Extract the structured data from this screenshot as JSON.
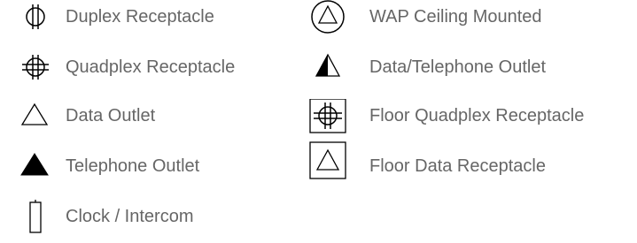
{
  "legend": {
    "items": [
      {
        "label": "Duplex Receptacle",
        "icon": "duplex-receptacle-symbol"
      },
      {
        "label": "Quadplex Receptacle",
        "icon": "quadplex-receptacle-symbol"
      },
      {
        "label": "Data Outlet",
        "icon": "data-outlet-symbol"
      },
      {
        "label": "Telephone Outlet",
        "icon": "telephone-outlet-symbol"
      },
      {
        "label": "Clock / Intercom",
        "icon": "clock-intercom-symbol"
      },
      {
        "label": "WAP Ceiling Mounted",
        "icon": "wap-ceiling-mounted-symbol"
      },
      {
        "label": "Data/Telephone Outlet",
        "icon": "data-telephone-outlet-symbol"
      },
      {
        "label": "Floor Quadplex Receptacle",
        "icon": "floor-quadplex-receptacle-symbol"
      },
      {
        "label": "Floor Data Receptacle",
        "icon": "floor-data-receptacle-symbol"
      }
    ]
  },
  "colors": {
    "symbol": "#000000",
    "label": "#666666",
    "background": "#ffffff"
  }
}
